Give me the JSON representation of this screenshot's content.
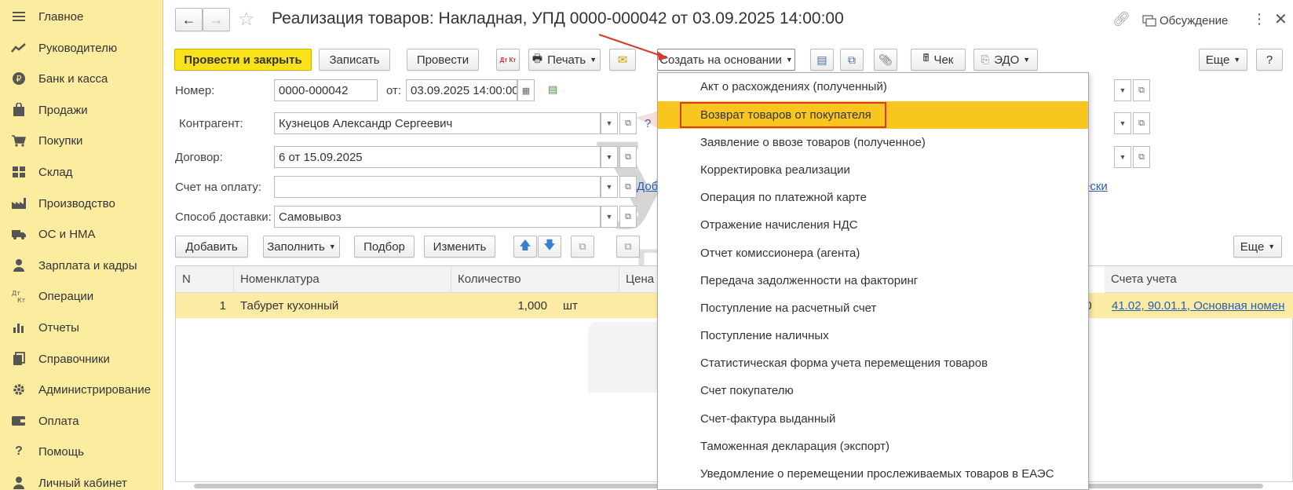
{
  "sidebar": {
    "items": [
      {
        "label": "Главное",
        "icon": "menu-icon"
      },
      {
        "label": "Руководителю",
        "icon": "chart-trend-icon"
      },
      {
        "label": "Банк и касса",
        "icon": "ruble-icon"
      },
      {
        "label": "Продажи",
        "icon": "bag-icon"
      },
      {
        "label": "Покупки",
        "icon": "cart-icon"
      },
      {
        "label": "Склад",
        "icon": "grid-icon"
      },
      {
        "label": "Производство",
        "icon": "factory-icon"
      },
      {
        "label": "ОС и НМА",
        "icon": "truck-icon"
      },
      {
        "label": "Зарплата и кадры",
        "icon": "person-icon"
      },
      {
        "label": "Операции",
        "icon": "debit-credit-icon"
      },
      {
        "label": "Отчеты",
        "icon": "bar-chart-icon"
      },
      {
        "label": "Справочники",
        "icon": "books-icon"
      },
      {
        "label": "Администрирование",
        "icon": "gear-icon"
      },
      {
        "label": "Оплата",
        "icon": "wallet-icon"
      },
      {
        "label": "Помощь",
        "icon": "help-icon"
      },
      {
        "label": "Личный кабинет",
        "icon": "person-icon"
      }
    ]
  },
  "header": {
    "title": "Реализация товаров: Накладная, УПД 0000-000042 от 03.09.2025 14:00:00",
    "discussion": "Обсуждение"
  },
  "toolbar": {
    "post_close": "Провести и закрыть",
    "save": "Записать",
    "post": "Провести",
    "dtkt": "Дт Кт",
    "print": "Печать",
    "create_based": "Создать на основании",
    "check": "Чек",
    "edo": "ЭДО",
    "more": "Еще",
    "help": "?"
  },
  "form": {
    "number_label": "Номер:",
    "number_value": "0000-000042",
    "from_label": "от:",
    "date_value": "03.09.2025 14:00:00",
    "contractor_label": "Контрагент:",
    "contractor_value": "Кузнецов Александр Сергеевич",
    "contract_label": "Договор:",
    "contract_value": "6 от 15.09.2025",
    "invoice_label": "Счет на оплату:",
    "invoice_value": "",
    "delivery_label": "Способ доставки:",
    "delivery_value": "Самовывоз",
    "link_partial": "Доб",
    "link_partial2": "ески",
    "help_q": "?"
  },
  "table_toolbar": {
    "add": "Добавить",
    "fill": "Заполнить",
    "select": "Подбор",
    "change": "Изменить",
    "more": "Еще"
  },
  "table": {
    "headers": [
      "N",
      "Номенклатура",
      "Количество",
      "Цена",
      "Счета учета"
    ],
    "row": {
      "n": "1",
      "item": "Табурет кухонный",
      "qty": "1,000",
      "unit": "шт",
      "partial": "00",
      "accounts": "41.02, 90.01.1, Основная номен"
    }
  },
  "dropdown": {
    "active_index": 1,
    "items": [
      "Акт о расхождениях (полученный)",
      "Возврат товаров от покупателя",
      "Заявление о ввозе товаров (полученное)",
      "Корректировка реализации",
      "Операция по платежной карте",
      "Отражение начисления НДС",
      "Отчет комиссионера (агента)",
      "Передача задолженности на факторинг",
      "Поступление на расчетный счет",
      "Поступление наличных",
      "Статистическая форма учета перемещения товаров",
      "Счет покупателю",
      "Счет-фактура выданный",
      "Таможенная декларация (экспорт)",
      "Уведомление о перемещении прослеживаемых товаров в ЕАЭС"
    ]
  },
  "watermark": {
    "line1": "УЧЕТ",
    "line2": "БЕЗ ЗАБОТ"
  },
  "colors": {
    "sidebar_bg": "#fbeca0",
    "accent_yellow": "#f9e21a",
    "menu_active": "#f9c61f",
    "highlight_red": "#d73a2f",
    "link_blue": "#2a5fb0"
  }
}
